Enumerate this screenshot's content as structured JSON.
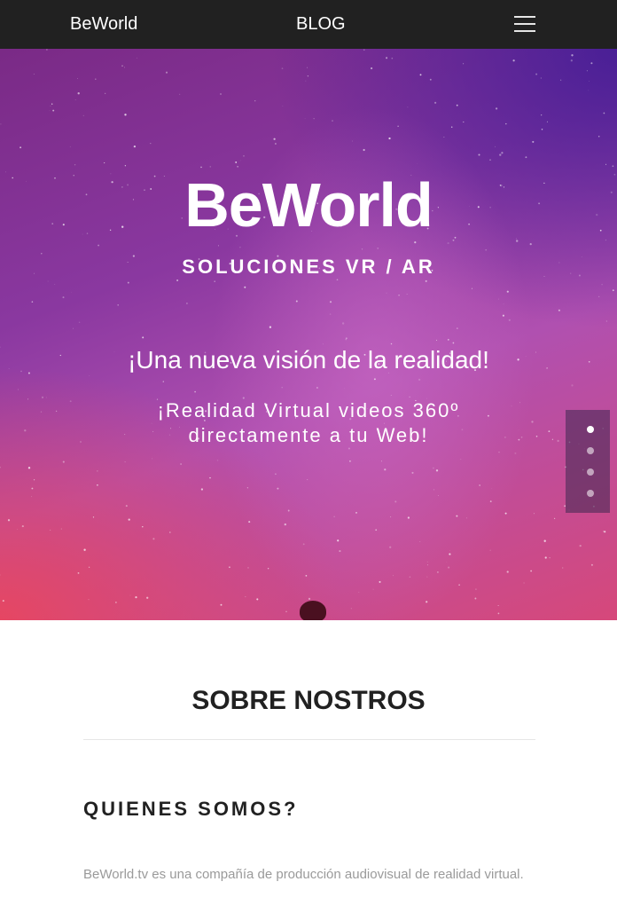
{
  "navbar": {
    "brand": "BeWorld",
    "blog_label": "BLOG",
    "menu_icon": "hamburger-menu-icon"
  },
  "hero": {
    "title": "BeWorld",
    "subtitle": "SOLUCIONES VR / AR",
    "tagline": "¡Una nueva visión de la realidad!",
    "description": "¡Realidad Virtual videos 360º directamente a tu Web!",
    "active_slide": 1,
    "slide_count": 4
  },
  "about": {
    "title": "SOBRE NOSTROS",
    "heading_prefix": "QUIENES ",
    "heading_bold": "SOMOS",
    "heading_suffix": "?",
    "body": "BeWorld.tv es una compañía de producción audiovisual de realidad virtual."
  },
  "colors": {
    "navbar_bg": "#212121",
    "text_dark": "#212121",
    "text_muted": "#9a9a9a"
  }
}
